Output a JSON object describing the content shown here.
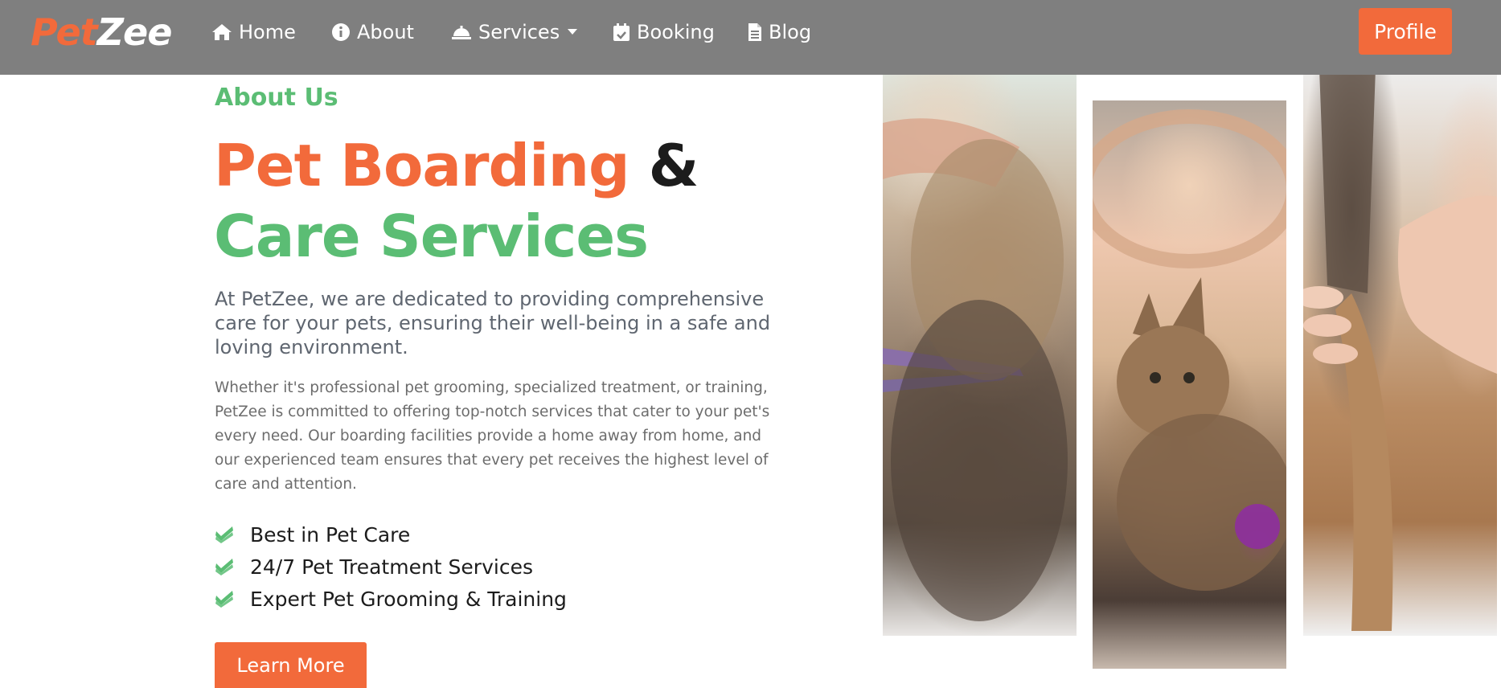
{
  "navbar": {
    "brand_part1": "Pet",
    "brand_part2": "Zee",
    "items": [
      {
        "label": "Home",
        "icon": "home-icon"
      },
      {
        "label": "About",
        "icon": "info-icon"
      },
      {
        "label": "Services",
        "icon": "service-bell-icon",
        "dropdown": true
      },
      {
        "label": "Booking",
        "icon": "calendar-check-icon"
      },
      {
        "label": "Blog",
        "icon": "document-icon"
      }
    ],
    "profile_label": "Profile"
  },
  "about": {
    "eyebrow": "About Us",
    "headline_part1": "Pet Boarding",
    "headline_part2": "&",
    "headline_part3": "Care Services",
    "lead": "At PetZee, we are dedicated to providing comprehensive care for your pets, ensuring their well-being in a safe and loving environment.",
    "body": "Whether it's professional pet grooming, specialized treatment, or training, PetZee is committed to offering top-notch services that cater to your pet's every need. Our boarding facilities provide a home away from home, and our experienced team ensures that every pet receives the highest level of care and attention.",
    "features": [
      "Best in Pet Care",
      "24/7 Pet Treatment Services",
      "Expert Pet Grooming & Training"
    ],
    "cta_label": "Learn More"
  },
  "colors": {
    "accent_orange": "#f26a3b",
    "accent_green": "#5bbd74",
    "navbar_bg": "#7f7f7f"
  }
}
